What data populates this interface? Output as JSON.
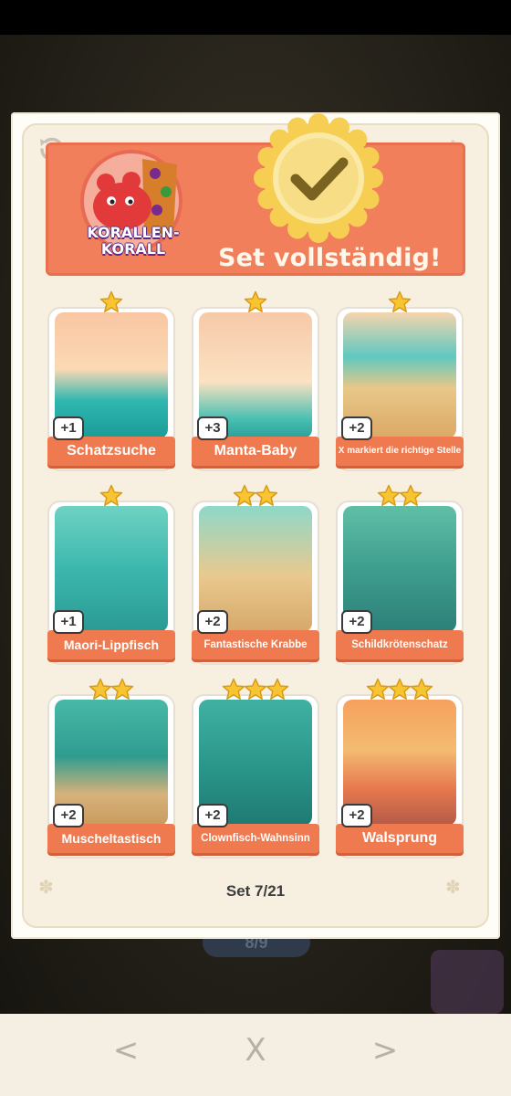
{
  "background": {
    "progress_pill": "8/9"
  },
  "header": {
    "title": "Set vollständig!",
    "badge_line1": "KORALLEN-",
    "badge_line2": "KORALL"
  },
  "cards": [
    {
      "name": "Schatzsuche",
      "count": "+1",
      "stars": 1,
      "art": "boat"
    },
    {
      "name": "Manta-Baby",
      "count": "+3",
      "stars": 1,
      "art": "manta"
    },
    {
      "name": "X markiert die richtige Stelle",
      "count": "+2",
      "stars": 1,
      "art": "beach"
    },
    {
      "name": "Maori-Lippfisch",
      "count": "+1",
      "stars": 1,
      "art": "fish"
    },
    {
      "name": "Fantastische Krabbe",
      "count": "+2",
      "stars": 2,
      "art": "crab"
    },
    {
      "name": "Schildkrötenschatz",
      "count": "+2",
      "stars": 2,
      "art": "turtle"
    },
    {
      "name": "Muscheltastisch",
      "count": "+2",
      "stars": 2,
      "art": "chest"
    },
    {
      "name": "Clownfisch-Wahnsinn",
      "count": "+2",
      "stars": 3,
      "art": "diver"
    },
    {
      "name": "Walsprung",
      "count": "+2",
      "stars": 3,
      "art": "sunset"
    }
  ],
  "footer": {
    "set_counter": "Set 7/21"
  },
  "navbar": {
    "prev": "<",
    "close": "X",
    "next": ">"
  },
  "colors": {
    "header": "#f27f5c",
    "banner": "#f07a4f",
    "star": "#f7c531",
    "check": "#7a6320"
  }
}
